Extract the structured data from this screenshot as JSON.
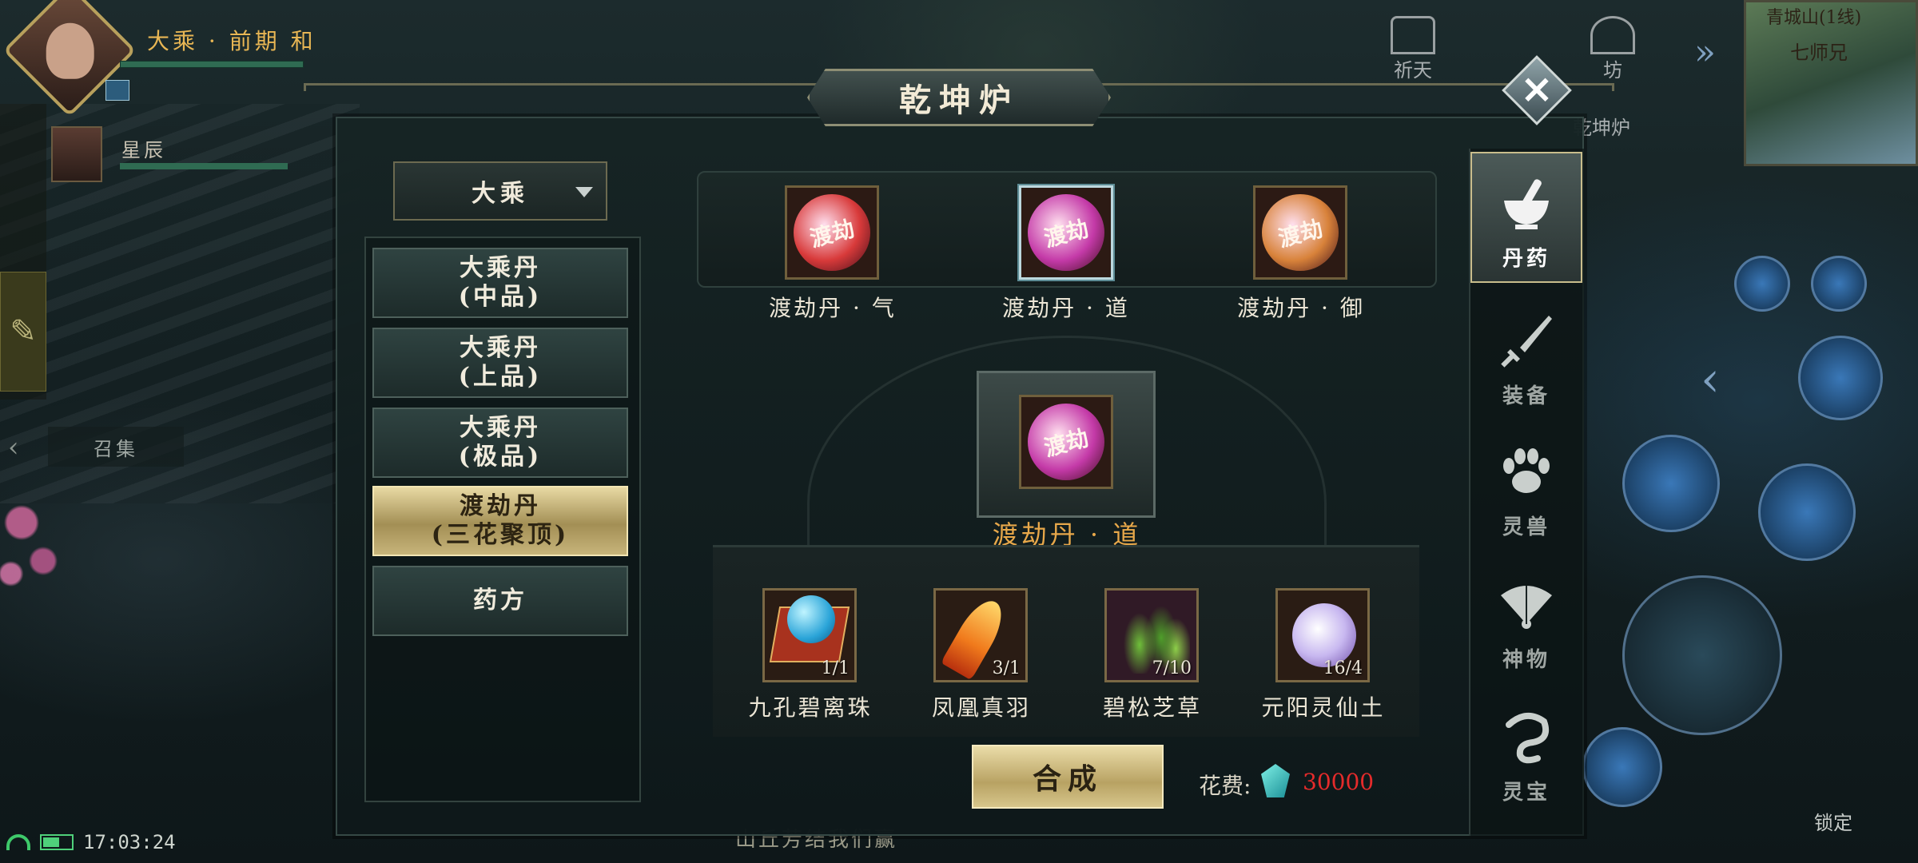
{
  "hud": {
    "player_realm": "大乘 · 前期  和",
    "ally_name": "星辰",
    "summon_label": "召集",
    "time": "17:03:24",
    "bottom_message": "山丘芳结我们赢",
    "minimap_title": "青城山(1线)",
    "minimap_sub": "七师兄",
    "lock_label": "锁定",
    "top_icons": [
      "祈天",
      "坊",
      "乾坤炉"
    ]
  },
  "panel": {
    "title": "乾坤炉",
    "close_label": "×"
  },
  "tier_select": {
    "selected": "大乘"
  },
  "recipes": [
    {
      "label": "大乘丹\n(中品)",
      "active": false
    },
    {
      "label": "大乘丹\n(上品)",
      "active": false
    },
    {
      "label": "大乘丹\n(极品)",
      "active": false
    },
    {
      "label": "渡劫丹\n(三花聚顶)",
      "active": true
    },
    {
      "label": "药方",
      "active": false
    }
  ],
  "pills": [
    {
      "name": "渡劫丹 · 气",
      "orb_text": "渡劫",
      "color": "#d83a3a",
      "selected": false
    },
    {
      "name": "渡劫丹 · 道",
      "orb_text": "渡劫",
      "color": "#c43aa8",
      "selected": true
    },
    {
      "name": "渡劫丹 · 御",
      "orb_text": "渡劫",
      "color": "#d8823a",
      "selected": false
    }
  ],
  "result": {
    "name": "渡劫丹 · 道",
    "orb_text": "渡劫",
    "color": "#c43aa8"
  },
  "ingredients": [
    {
      "name": "九孔碧离珠",
      "count": "1/1",
      "icon": "blue-pearl-icon"
    },
    {
      "name": "凤凰真羽",
      "count": "3/1",
      "icon": "phoenix-feather-icon"
    },
    {
      "name": "碧松芝草",
      "count": "7/10",
      "icon": "herb-icon"
    },
    {
      "name": "元阳灵仙土",
      "count": "16/4",
      "icon": "vase-icon"
    }
  ],
  "actions": {
    "synthesize_label": "合成",
    "cost_label": "花费:",
    "cost_value": "30000"
  },
  "categories": [
    {
      "label": "丹药",
      "icon": "mortar-icon",
      "active": true
    },
    {
      "label": "装备",
      "icon": "sword-icon",
      "active": false
    },
    {
      "label": "灵兽",
      "icon": "paw-icon",
      "active": false
    },
    {
      "label": "神物",
      "icon": "fan-icon",
      "active": false
    },
    {
      "label": "灵宝",
      "icon": "scroll-icon",
      "active": false
    }
  ],
  "colors": {
    "accent_gold": "#e8a84a",
    "cost_red": "#e52b2b",
    "active_tab": "#c9bd8c"
  }
}
